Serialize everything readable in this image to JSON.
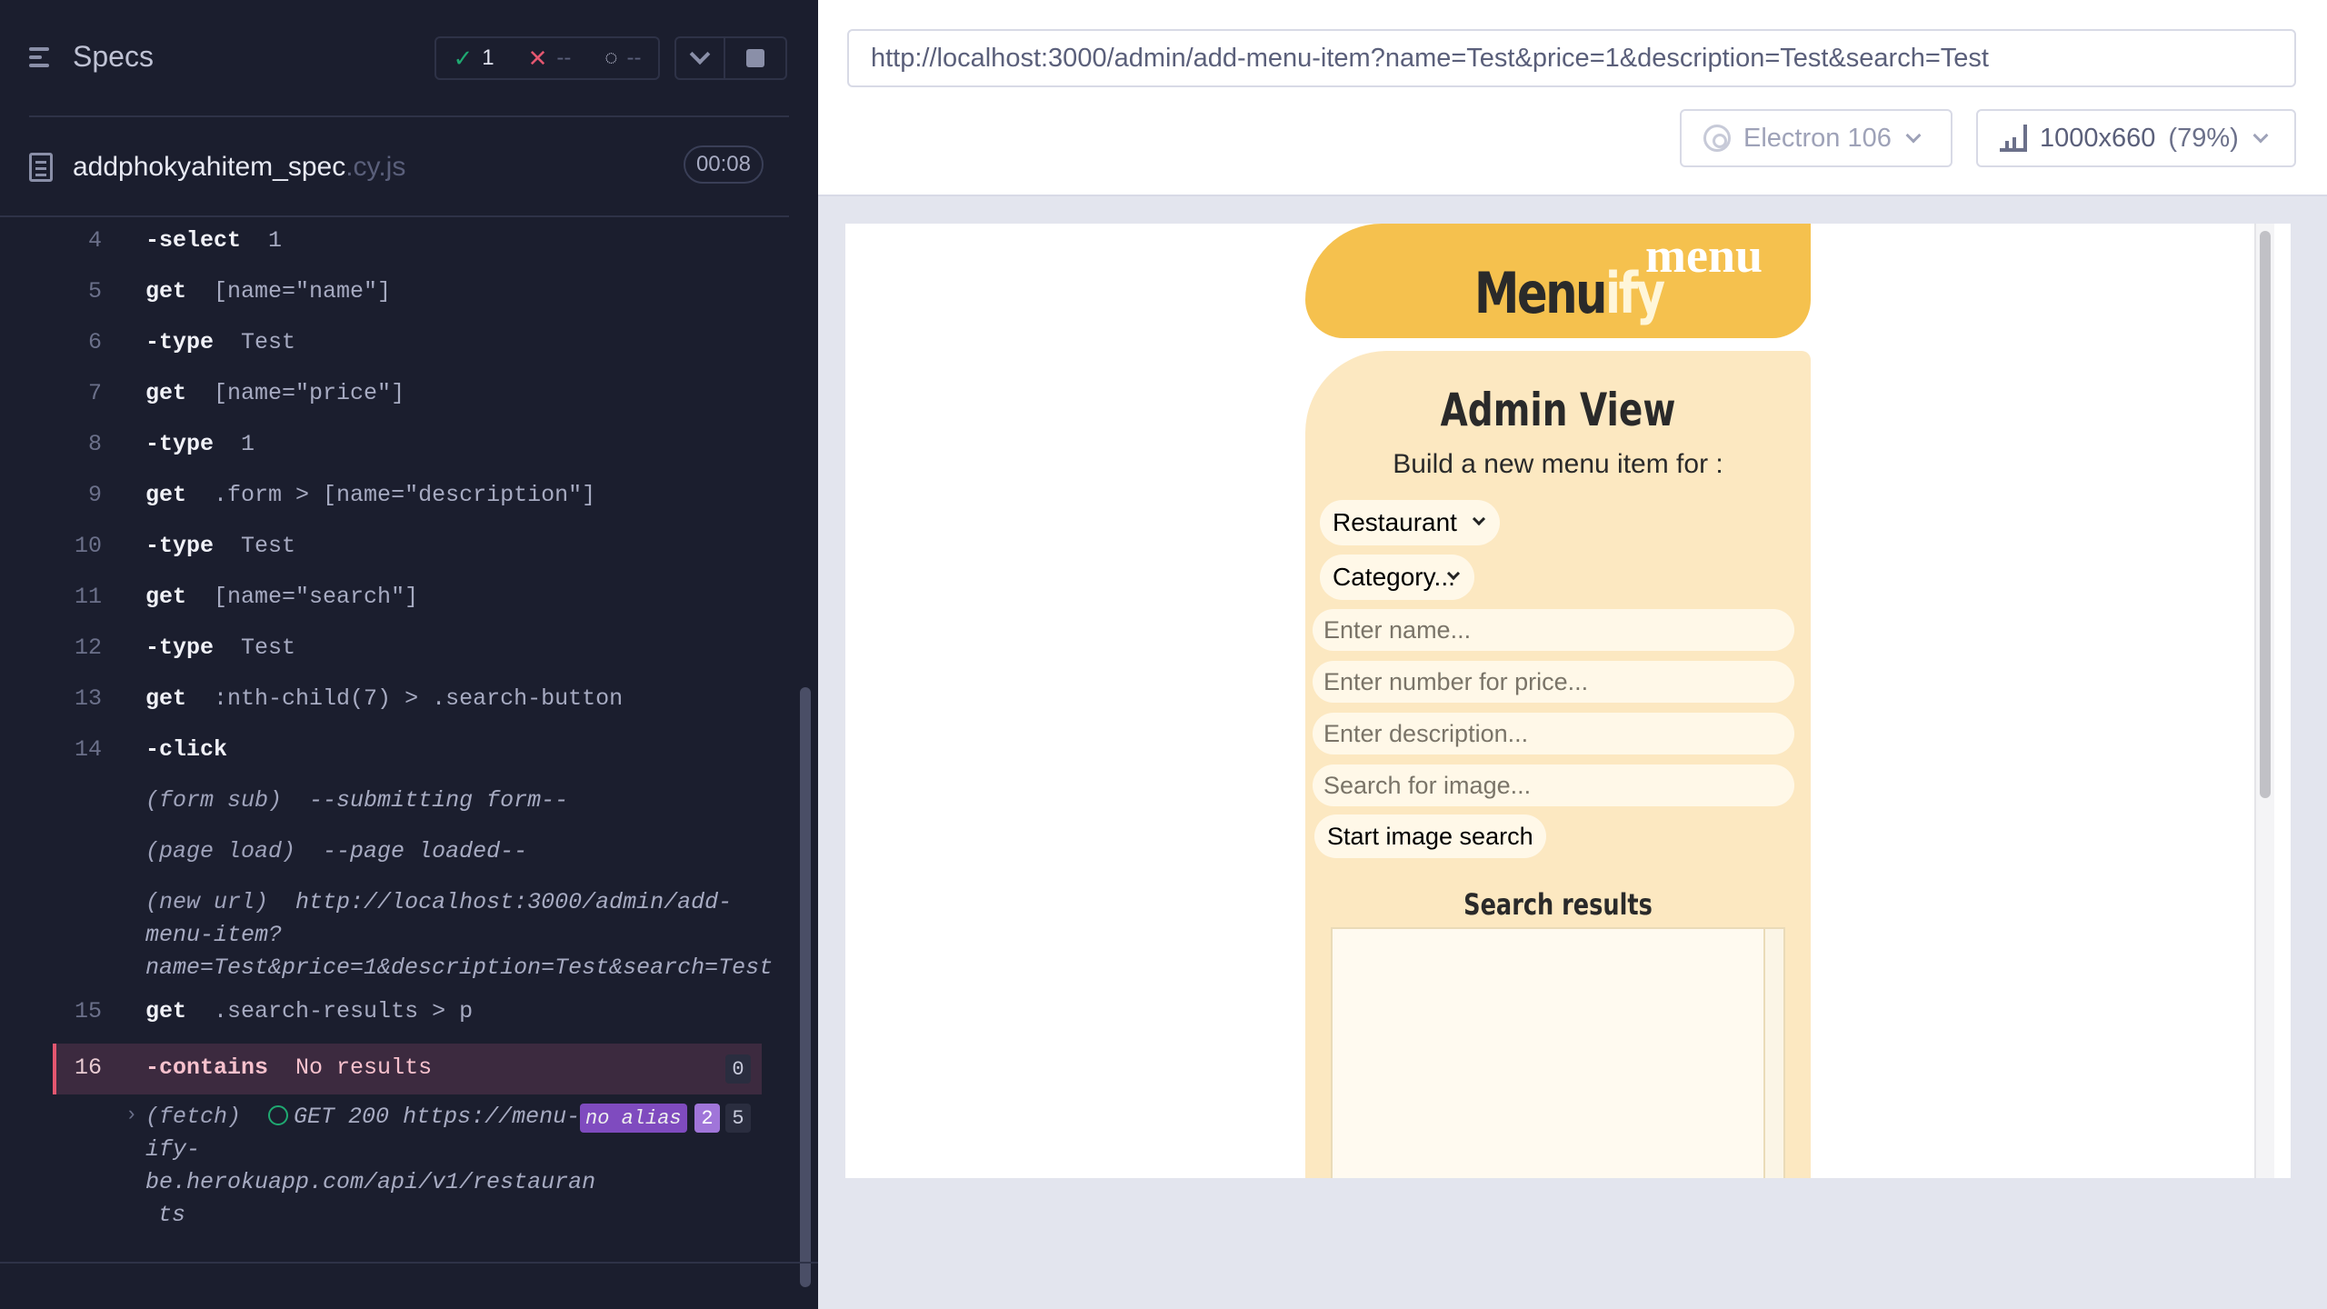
{
  "reporter": {
    "specs_label": "Specs",
    "stats": {
      "passed": "1",
      "failed": "--",
      "pending": "--"
    },
    "spec_file": {
      "name": "addphokyahitem_spec",
      "ext": ".cy.js",
      "duration": "00:08"
    },
    "commands": [
      {
        "num": "4",
        "name": "-select",
        "arg": "1"
      },
      {
        "num": "5",
        "name": "get",
        "arg": "[name=\"name\"]"
      },
      {
        "num": "6",
        "name": "-type",
        "arg": "Test"
      },
      {
        "num": "7",
        "name": "get",
        "arg": "[name=\"price\"]"
      },
      {
        "num": "8",
        "name": "-type",
        "arg": "1"
      },
      {
        "num": "9",
        "name": "get",
        "arg": ".form > [name=\"description\"]"
      },
      {
        "num": "10",
        "name": "-type",
        "arg": "Test"
      },
      {
        "num": "11",
        "name": "get",
        "arg": "[name=\"search\"]"
      },
      {
        "num": "12",
        "name": "-type",
        "arg": "Test"
      },
      {
        "num": "13",
        "name": "get",
        "arg": ":nth-child(7) > .search-button"
      },
      {
        "num": "14",
        "name": "-click",
        "arg": ""
      }
    ],
    "events": [
      {
        "label": "(form sub)",
        "text": "--submitting form--"
      },
      {
        "label": "(page load)",
        "text": "--page loaded--"
      },
      {
        "label": "(new url)",
        "text_lines": [
          "http://localhost:3000/admin/add-",
          "menu-item?",
          "name=Test&price=1&description=Test&search=Test"
        ]
      }
    ],
    "cmd15": {
      "num": "15",
      "name": "get",
      "arg": ".search-results > p"
    },
    "cmd16": {
      "num": "16",
      "name": "-contains",
      "arg": "No results",
      "count": "0"
    },
    "fetch": {
      "label": "(fetch)",
      "lines": [
        "GET 200 https://menu-",
        "ify-",
        "be.herokuapp.com/api/v1/restauran",
        "ts"
      ],
      "alias": "no alias",
      "alias_count": "2",
      "count": "5"
    }
  },
  "aut": {
    "url": "http://localhost:3000/admin/add-menu-item?name=Test&price=1&description=Test&search=Test",
    "browser": "Electron 106",
    "viewport": "1000x660",
    "viewport_pct": "(79%)",
    "app": {
      "logo_small": "menu",
      "logo_main": "Menu",
      "logo_suffix": "ify",
      "title": "Admin View",
      "subtitle": "Build a new menu item for :",
      "restaurant_select": "Restaurant",
      "category_select": "Category...",
      "name_placeholder": "Enter name...",
      "price_placeholder": "Enter number for price...",
      "description_placeholder": "Enter description...",
      "search_placeholder": "Search for image...",
      "search_button": "Start image search",
      "results_title": "Search results"
    }
  },
  "colors": {
    "reporter_bg": "#1b1e2e",
    "pass_green": "#1fa971",
    "fail_red": "#e45770",
    "logo_yellow": "#f5c14e",
    "card_cream": "#fce8c1"
  }
}
